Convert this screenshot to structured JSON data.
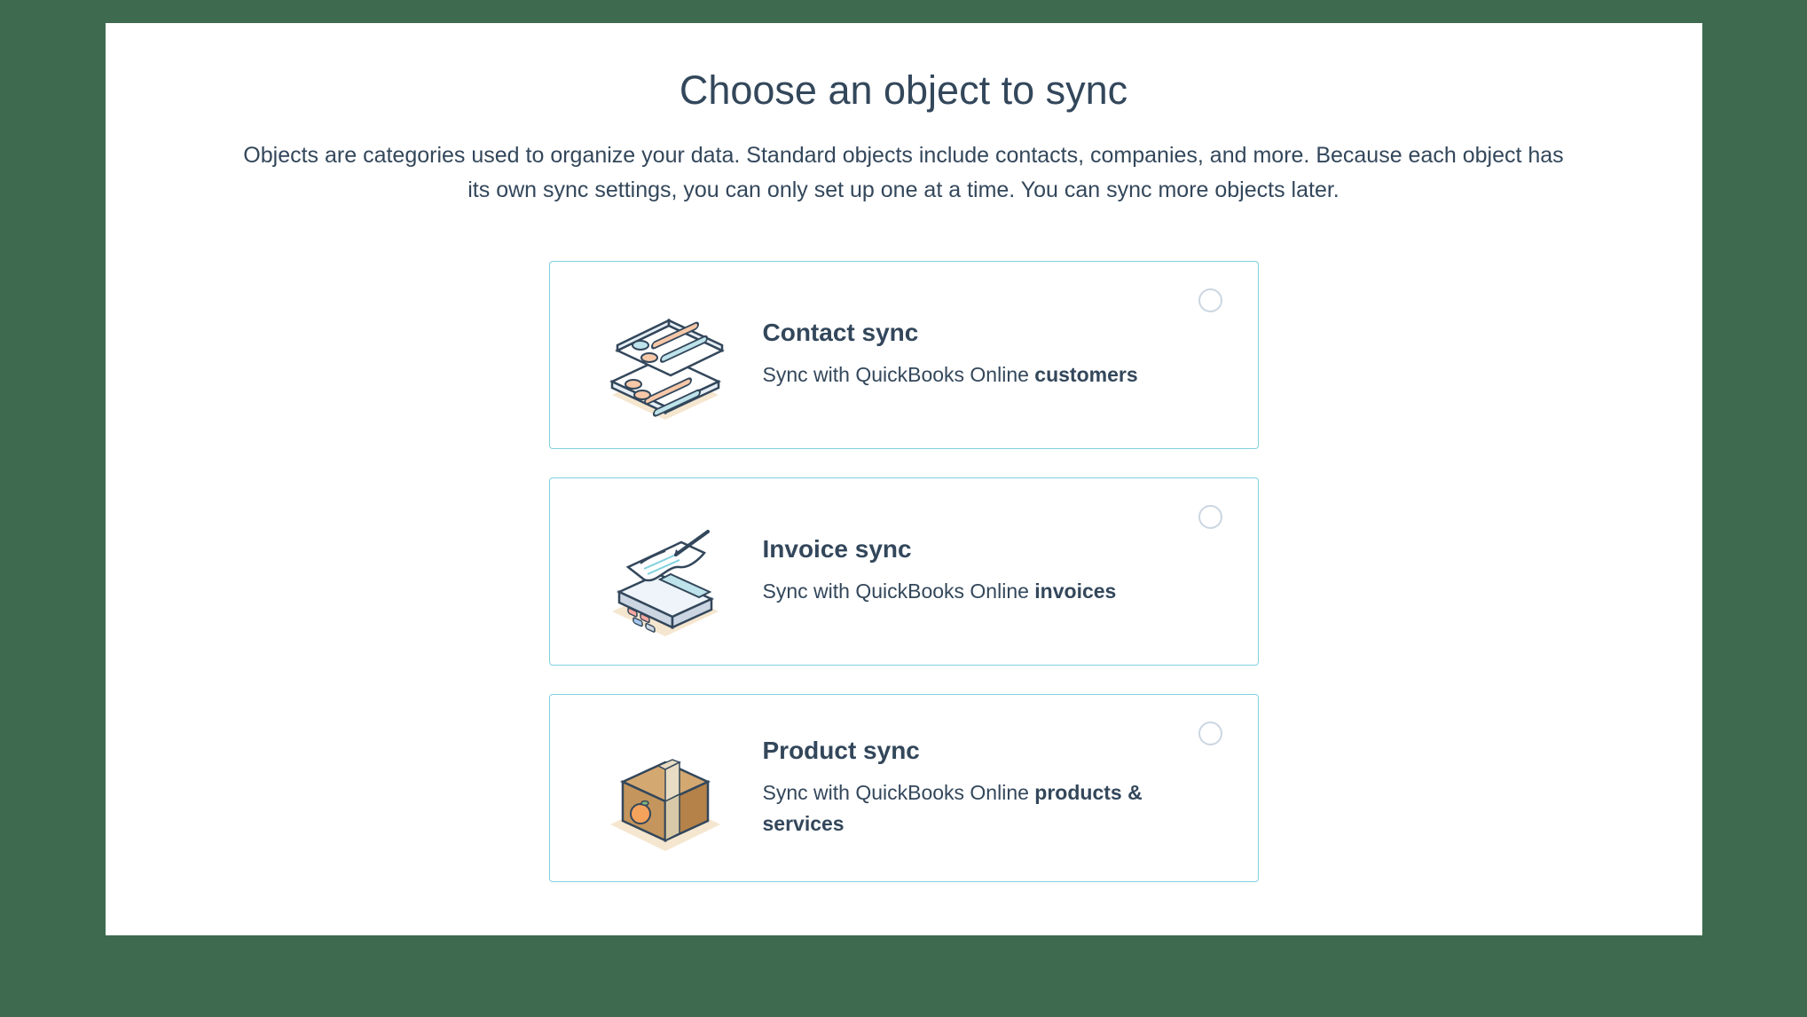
{
  "heading": "Choose an object to sync",
  "subtext": "Objects are categories used to organize your data. Standard objects include contacts, companies, and more. Because each object has its own sync settings, you can only set up one at a time. You can sync more objects later.",
  "cards": [
    {
      "title": "Contact sync",
      "desc_prefix": "Sync with QuickBooks Online ",
      "desc_strong": "customers"
    },
    {
      "title": "Invoice sync",
      "desc_prefix": "Sync with QuickBooks Online ",
      "desc_strong": "invoices"
    },
    {
      "title": "Product sync",
      "desc_prefix": "Sync with QuickBooks Online ",
      "desc_strong": "products & services"
    }
  ]
}
